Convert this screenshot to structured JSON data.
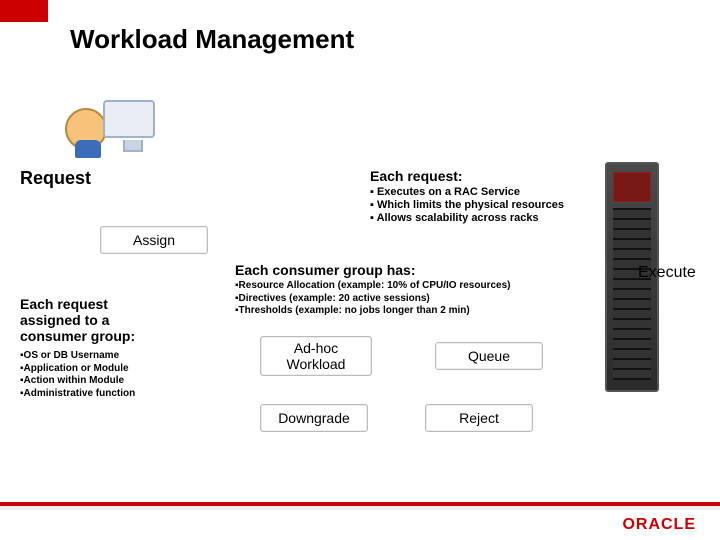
{
  "title": "Workload Management",
  "request_label": "Request",
  "each_request": {
    "heading": "Each request:",
    "b1": "Executes on a RAC Service",
    "b2": "Which limits the physical resources",
    "b3": "Allows scalability across racks"
  },
  "assign_label": "Assign",
  "consumer_group": {
    "heading": "Each request assigned to a consumer group:",
    "b1": "OS or DB Username",
    "b2": "Application or Module",
    "b3": "Action within Module",
    "b4": "Administrative function"
  },
  "cg_has": {
    "heading": "Each consumer group has:",
    "b1": "Resource Allocation (example: 10% of CPU/IO resources)",
    "b2": "Directives (example: 20 active sessions)",
    "b3": "Thresholds (example: no jobs longer than 2 min)"
  },
  "boxes": {
    "adhoc_l1": "Ad-hoc",
    "adhoc_l2": "Workload",
    "queue": "Queue",
    "downgrade": "Downgrade",
    "reject": "Reject"
  },
  "execute_label": "Execute",
  "logo": "ORACLE",
  "colors": {
    "accent": "#c00"
  }
}
